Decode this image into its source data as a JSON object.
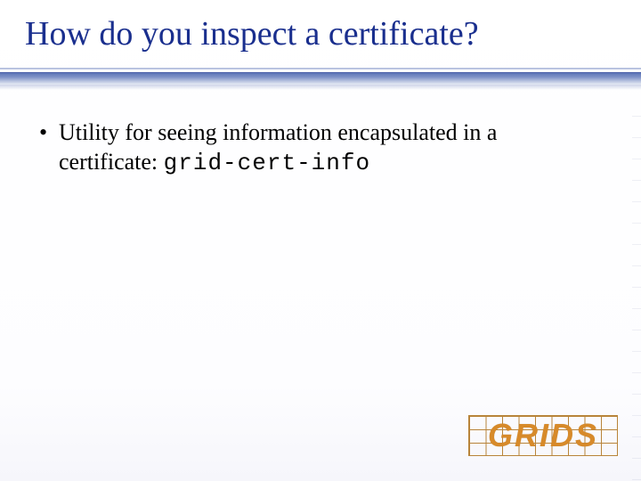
{
  "title": "How do you inspect a certificate?",
  "bullets": [
    {
      "text": "Utility for seeing information encapsulated in a certificate: ",
      "code": "grid-cert-info"
    }
  ],
  "logo": {
    "text": "GRIDS"
  }
}
